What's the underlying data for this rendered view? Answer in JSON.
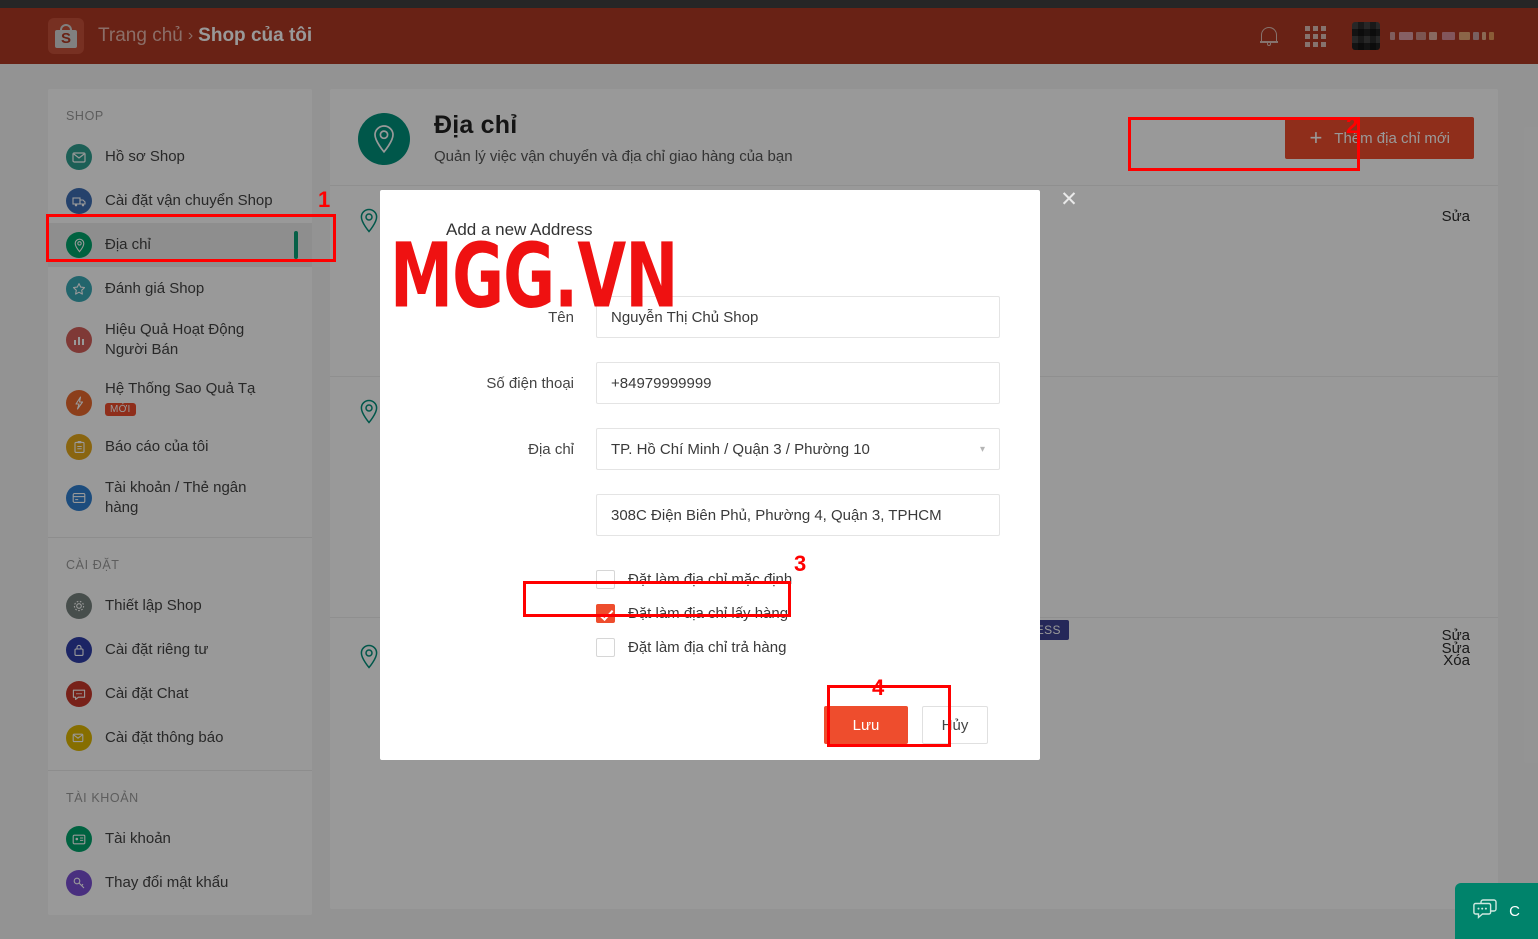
{
  "topbar": {
    "logo_letter": "S",
    "breadcrumb_home": "Trang chủ",
    "breadcrumb_sep": "›",
    "breadcrumb_current": "Shop của tôi",
    "bell_icon": "bell-icon",
    "apps_icon": "grid-apps-icon",
    "brand_color": "#b03a23"
  },
  "sidebar": {
    "groups": [
      {
        "title": "SHOP",
        "items": [
          {
            "label": "Hồ sơ Shop",
            "icon": "profile-icon",
            "color": "#2f9e8f",
            "active": false
          },
          {
            "label": "Cài đặt vận chuyển Shop",
            "icon": "truck-icon",
            "color": "#3f6fb5",
            "active": false
          },
          {
            "label": "Địa chỉ",
            "icon": "location-pin-icon",
            "color": "#00a36c",
            "active": true
          },
          {
            "label": "Đánh giá Shop",
            "icon": "star-icon",
            "color": "#3aa8b5",
            "active": false
          },
          {
            "label": "Hiệu Quả Hoạt Động Người Bán",
            "icon": "bar-chart-icon",
            "color": "#d4605a",
            "active": false
          },
          {
            "label": "Hệ Thống Sao Quả Tạ",
            "icon": "lightning-icon",
            "color": "#ea6a2e",
            "active": false,
            "badge": "MỚI"
          },
          {
            "label": "Báo cáo của tôi",
            "icon": "clipboard-icon",
            "color": "#e5a81c",
            "active": false
          },
          {
            "label": "Tài khoản / Thẻ ngân hàng",
            "icon": "credit-card-icon",
            "color": "#2f7fd1",
            "active": false
          }
        ]
      },
      {
        "title": "CÀI ĐẶT",
        "items": [
          {
            "label": "Thiết lập Shop",
            "icon": "gear-icon",
            "color": "#77837f",
            "active": false
          },
          {
            "label": "Cài đặt riêng tư",
            "icon": "lock-icon",
            "color": "#2f3fa8",
            "active": false
          },
          {
            "label": "Cài đặt Chat",
            "icon": "chat-icon",
            "color": "#c8372b",
            "active": false
          },
          {
            "label": "Cài đặt thông báo",
            "icon": "notification-mail-icon",
            "color": "#e0b800",
            "active": false
          }
        ]
      },
      {
        "title": "TÀI KHOẢN",
        "items": [
          {
            "label": "Tài khoản",
            "icon": "id-card-icon",
            "color": "#00a36c",
            "active": false
          },
          {
            "label": "Thay đổi mật khẩu",
            "icon": "key-icon",
            "color": "#7b4fd4",
            "active": false
          }
        ]
      }
    ]
  },
  "page": {
    "pin_icon": "location-pin-icon",
    "title": "Địa chỉ",
    "subtitle": "Quản lý việc vận chuyển và địa chỉ giao hàng của bạn",
    "add_button_label": "Thêm địa chỉ mới",
    "add_button_plus": "+",
    "edit_label": "Sửa",
    "delete_label": "Xóa",
    "default_tag": "N ADDRESS",
    "address_label": "Địa chỉ",
    "name_label": "Tên"
  },
  "modal": {
    "title": "Add a new Address",
    "close_icon": "close-icon",
    "fields": [
      {
        "label": "Tên",
        "value": "Nguyễn Thị Chủ Shop",
        "type": "text",
        "label_obscured": true
      },
      {
        "label": "Số điện thoại",
        "value": "+84979999999",
        "type": "text"
      },
      {
        "label": "Địa chỉ",
        "value": "TP. Hồ Chí Minh / Quận 3 / Phường 10",
        "type": "select"
      },
      {
        "label": "",
        "value": "308C Điện Biên Phủ, Phường 4, Quận 3, TPHCM",
        "type": "text"
      }
    ],
    "checkboxes": [
      {
        "label": "Đặt làm địa chỉ mặc định",
        "checked": false
      },
      {
        "label": "Đặt làm địa chỉ lấy hàng",
        "checked": true
      },
      {
        "label": "Đặt làm địa chỉ trả hàng",
        "checked": false
      }
    ],
    "save_label": "Lưu",
    "cancel_label": "Hủy",
    "accent_color": "#ee4d2d"
  },
  "watermark": {
    "text": "MGG.VN",
    "color": "#ef1111"
  },
  "annotations": [
    {
      "number": "1"
    },
    {
      "number": "2"
    },
    {
      "number": "3"
    },
    {
      "number": "4"
    }
  ],
  "chat": {
    "label": "C",
    "icon": "chat-bubble-icon"
  }
}
